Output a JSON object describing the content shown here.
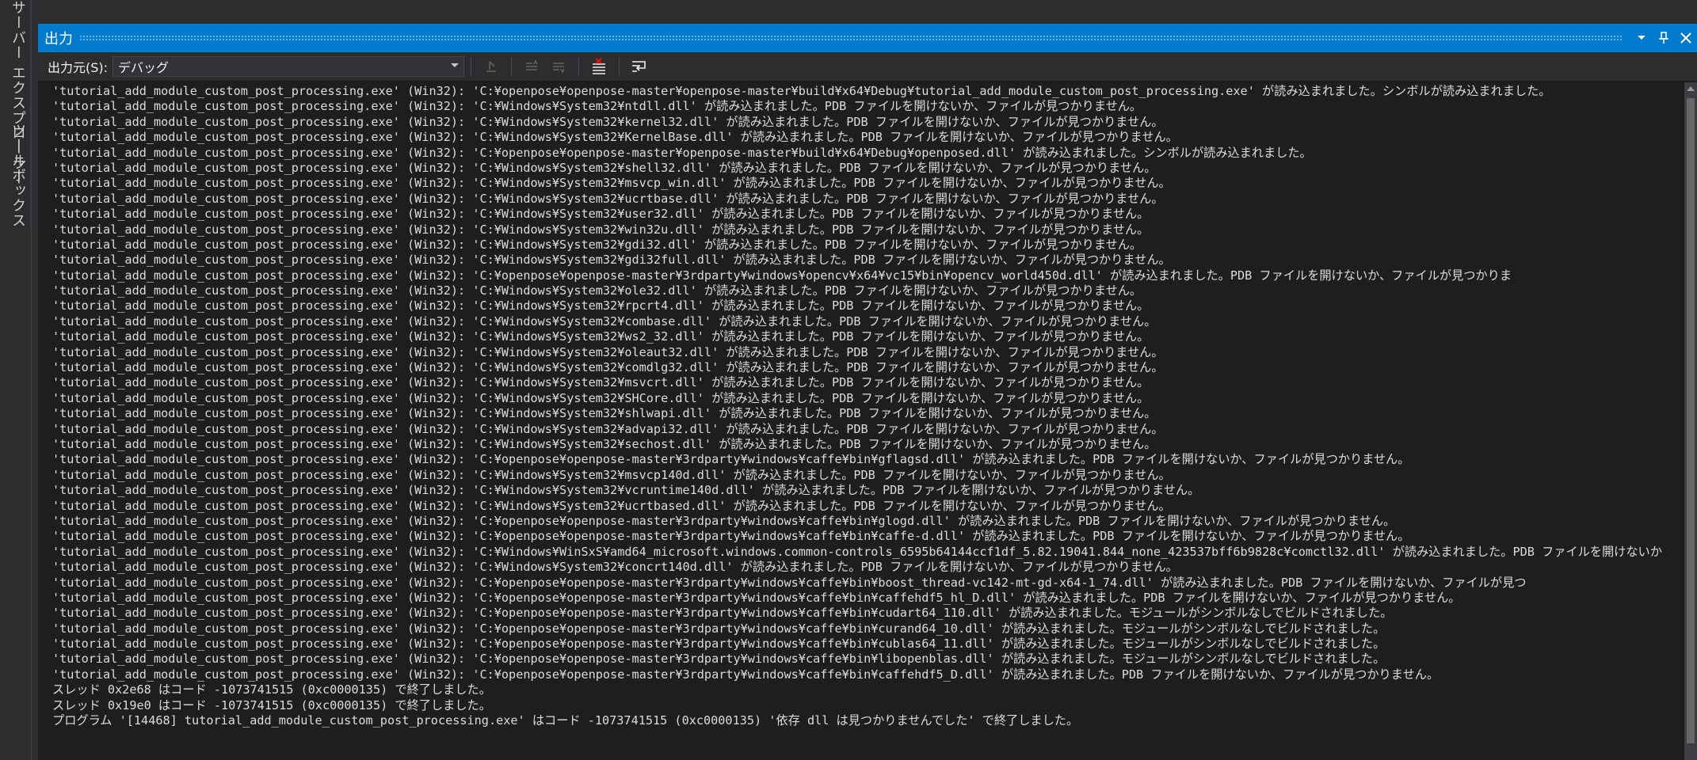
{
  "sidebar": {
    "tabs": [
      "サーバー エクスプローラー",
      "ツールボックス"
    ]
  },
  "panel": {
    "title": "出力",
    "source_label": "出力元(S):",
    "source_value": "デバッグ"
  },
  "output_lines": [
    "'tutorial_add_module_custom_post_processing.exe' (Win32): 'C:¥openpose¥openpose-master¥openpose-master¥build¥x64¥Debug¥tutorial_add_module_custom_post_processing.exe' が読み込まれました。シンボルが読み込まれました。",
    "'tutorial_add_module_custom_post_processing.exe' (Win32): 'C:¥Windows¥System32¥ntdll.dll' が読み込まれました。PDB ファイルを開けないか、ファイルが見つかりません。",
    "'tutorial_add_module_custom_post_processing.exe' (Win32): 'C:¥Windows¥System32¥kernel32.dll' が読み込まれました。PDB ファイルを開けないか、ファイルが見つかりません。",
    "'tutorial_add_module_custom_post_processing.exe' (Win32): 'C:¥Windows¥System32¥KernelBase.dll' が読み込まれました。PDB ファイルを開けないか、ファイルが見つかりません。",
    "'tutorial_add_module_custom_post_processing.exe' (Win32): 'C:¥openpose¥openpose-master¥openpose-master¥build¥x64¥Debug¥openposed.dll' が読み込まれました。シンボルが読み込まれました。",
    "'tutorial_add_module_custom_post_processing.exe' (Win32): 'C:¥Windows¥System32¥shell32.dll' が読み込まれました。PDB ファイルを開けないか、ファイルが見つかりません。",
    "'tutorial_add_module_custom_post_processing.exe' (Win32): 'C:¥Windows¥System32¥msvcp_win.dll' が読み込まれました。PDB ファイルを開けないか、ファイルが見つかりません。",
    "'tutorial_add_module_custom_post_processing.exe' (Win32): 'C:¥Windows¥System32¥ucrtbase.dll' が読み込まれました。PDB ファイルを開けないか、ファイルが見つかりません。",
    "'tutorial_add_module_custom_post_processing.exe' (Win32): 'C:¥Windows¥System32¥user32.dll' が読み込まれました。PDB ファイルを開けないか、ファイルが見つかりません。",
    "'tutorial_add_module_custom_post_processing.exe' (Win32): 'C:¥Windows¥System32¥win32u.dll' が読み込まれました。PDB ファイルを開けないか、ファイルが見つかりません。",
    "'tutorial_add_module_custom_post_processing.exe' (Win32): 'C:¥Windows¥System32¥gdi32.dll' が読み込まれました。PDB ファイルを開けないか、ファイルが見つかりません。",
    "'tutorial_add_module_custom_post_processing.exe' (Win32): 'C:¥Windows¥System32¥gdi32full.dll' が読み込まれました。PDB ファイルを開けないか、ファイルが見つかりません。",
    "'tutorial_add_module_custom_post_processing.exe' (Win32): 'C:¥openpose¥openpose-master¥3rdparty¥windows¥opencv¥x64¥vc15¥bin¥opencv_world450d.dll' が読み込まれました。PDB ファイルを開けないか、ファイルが見つかりま",
    "'tutorial_add_module_custom_post_processing.exe' (Win32): 'C:¥Windows¥System32¥ole32.dll' が読み込まれました。PDB ファイルを開けないか、ファイルが見つかりません。",
    "'tutorial_add_module_custom_post_processing.exe' (Win32): 'C:¥Windows¥System32¥rpcrt4.dll' が読み込まれました。PDB ファイルを開けないか、ファイルが見つかりません。",
    "'tutorial_add_module_custom_post_processing.exe' (Win32): 'C:¥Windows¥System32¥combase.dll' が読み込まれました。PDB ファイルを開けないか、ファイルが見つかりません。",
    "'tutorial_add_module_custom_post_processing.exe' (Win32): 'C:¥Windows¥System32¥ws2_32.dll' が読み込まれました。PDB ファイルを開けないか、ファイルが見つかりません。",
    "'tutorial_add_module_custom_post_processing.exe' (Win32): 'C:¥Windows¥System32¥oleaut32.dll' が読み込まれました。PDB ファイルを開けないか、ファイルが見つかりません。",
    "'tutorial_add_module_custom_post_processing.exe' (Win32): 'C:¥Windows¥System32¥comdlg32.dll' が読み込まれました。PDB ファイルを開けないか、ファイルが見つかりません。",
    "'tutorial_add_module_custom_post_processing.exe' (Win32): 'C:¥Windows¥System32¥msvcrt.dll' が読み込まれました。PDB ファイルを開けないか、ファイルが見つかりません。",
    "'tutorial_add_module_custom_post_processing.exe' (Win32): 'C:¥Windows¥System32¥SHCore.dll' が読み込まれました。PDB ファイルを開けないか、ファイルが見つかりません。",
    "'tutorial_add_module_custom_post_processing.exe' (Win32): 'C:¥Windows¥System32¥shlwapi.dll' が読み込まれました。PDB ファイルを開けないか、ファイルが見つかりません。",
    "'tutorial_add_module_custom_post_processing.exe' (Win32): 'C:¥Windows¥System32¥advapi32.dll' が読み込まれました。PDB ファイルを開けないか、ファイルが見つかりません。",
    "'tutorial_add_module_custom_post_processing.exe' (Win32): 'C:¥Windows¥System32¥sechost.dll' が読み込まれました。PDB ファイルを開けないか、ファイルが見つかりません。",
    "'tutorial_add_module_custom_post_processing.exe' (Win32): 'C:¥openpose¥openpose-master¥3rdparty¥windows¥caffe¥bin¥gflagsd.dll' が読み込まれました。PDB ファイルを開けないか、ファイルが見つかりません。",
    "'tutorial_add_module_custom_post_processing.exe' (Win32): 'C:¥Windows¥System32¥msvcp140d.dll' が読み込まれました。PDB ファイルを開けないか、ファイルが見つかりません。",
    "'tutorial_add_module_custom_post_processing.exe' (Win32): 'C:¥Windows¥System32¥vcruntime140d.dll' が読み込まれました。PDB ファイルを開けないか、ファイルが見つかりません。",
    "'tutorial_add_module_custom_post_processing.exe' (Win32): 'C:¥Windows¥System32¥ucrtbased.dll' が読み込まれました。PDB ファイルを開けないか、ファイルが見つかりません。",
    "'tutorial_add_module_custom_post_processing.exe' (Win32): 'C:¥openpose¥openpose-master¥3rdparty¥windows¥caffe¥bin¥glogd.dll' が読み込まれました。PDB ファイルを開けないか、ファイルが見つかりません。",
    "'tutorial_add_module_custom_post_processing.exe' (Win32): 'C:¥openpose¥openpose-master¥3rdparty¥windows¥caffe¥bin¥caffe-d.dll' が読み込まれました。PDB ファイルを開けないか、ファイルが見つかりません。",
    "'tutorial_add_module_custom_post_processing.exe' (Win32): 'C:¥Windows¥WinSxS¥amd64_microsoft.windows.common-controls_6595b64144ccf1df_5.82.19041.844_none_423537bff6b9828c¥comctl32.dll' が読み込まれました。PDB ファイルを開けないか",
    "'tutorial_add_module_custom_post_processing.exe' (Win32): 'C:¥Windows¥System32¥concrt140d.dll' が読み込まれました。PDB ファイルを開けないか、ファイルが見つかりません。",
    "'tutorial_add_module_custom_post_processing.exe' (Win32): 'C:¥openpose¥openpose-master¥3rdparty¥windows¥caffe¥bin¥boost_thread-vc142-mt-gd-x64-1_74.dll' が読み込まれました。PDB ファイルを開けないか、ファイルが見つ",
    "'tutorial_add_module_custom_post_processing.exe' (Win32): 'C:¥openpose¥openpose-master¥3rdparty¥windows¥caffe¥bin¥caffehdf5_hl_D.dll' が読み込まれました。PDB ファイルを開けないか、ファイルが見つかりません。",
    "'tutorial_add_module_custom_post_processing.exe' (Win32): 'C:¥openpose¥openpose-master¥3rdparty¥windows¥caffe¥bin¥cudart64_110.dll' が読み込まれました。モジュールがシンボルなしでビルドされました。",
    "'tutorial_add_module_custom_post_processing.exe' (Win32): 'C:¥openpose¥openpose-master¥3rdparty¥windows¥caffe¥bin¥curand64_10.dll' が読み込まれました。モジュールがシンボルなしでビルドされました。",
    "'tutorial_add_module_custom_post_processing.exe' (Win32): 'C:¥openpose¥openpose-master¥3rdparty¥windows¥caffe¥bin¥cublas64_11.dll' が読み込まれました。モジュールがシンボルなしでビルドされました。",
    "'tutorial_add_module_custom_post_processing.exe' (Win32): 'C:¥openpose¥openpose-master¥3rdparty¥windows¥caffe¥bin¥libopenblas.dll' が読み込まれました。モジュールがシンボルなしでビルドされました。",
    "'tutorial_add_module_custom_post_processing.exe' (Win32): 'C:¥openpose¥openpose-master¥3rdparty¥windows¥caffe¥bin¥caffehdf5_D.dll' が読み込まれました。PDB ファイルを開けないか、ファイルが見つかりません。",
    "スレッド 0x2e68 はコード -1073741515 (0xc0000135) で終了しました。",
    "スレッド 0x19e0 はコード -1073741515 (0xc0000135) で終了しました。",
    "プログラム '[14468] tutorial_add_module_custom_post_processing.exe' はコード -1073741515 (0xc0000135) '依存 dll は見つかりませんでした' で終了しました。"
  ],
  "icons": {
    "window_menu": "chevron-down-icon",
    "pin": "pin-icon",
    "close": "close-icon",
    "find_message": "find-message-icon",
    "prev_message": "prev-message-icon",
    "next_message": "next-message-icon",
    "clear_all": "clear-all-icon",
    "word_wrap": "word-wrap-icon"
  },
  "colors": {
    "accent": "#007acc",
    "panel_bg": "#1e1e1e",
    "chrome_bg": "#2d2d30",
    "text": "#dcdcdc",
    "clear_icon_red": "#e51400"
  }
}
